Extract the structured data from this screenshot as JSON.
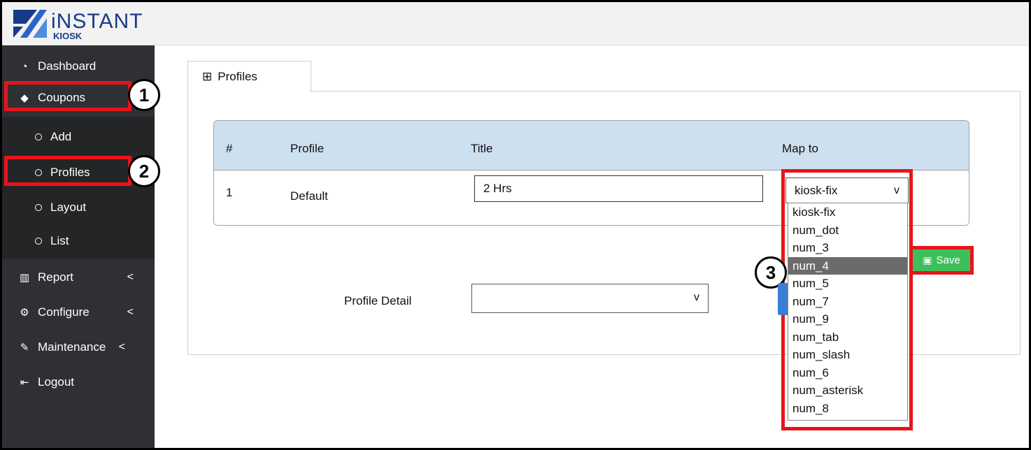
{
  "app": {
    "brand": "iNSTANT",
    "brand_sub": "KIOSK"
  },
  "sidebar": {
    "items": [
      {
        "icon": "dashboard-icon",
        "label": "Dashboard"
      },
      {
        "icon": "tag-icon",
        "label": "Coupons"
      },
      {
        "icon": "bar-chart-icon",
        "label": "Report"
      },
      {
        "icon": "gear-icon",
        "label": "Configure"
      },
      {
        "icon": "wrench-icon",
        "label": "Maintenance"
      },
      {
        "icon": "logout-icon",
        "label": "Logout"
      }
    ],
    "coupons_sub": [
      {
        "label": "Add"
      },
      {
        "label": "Profiles"
      },
      {
        "label": "Layout"
      },
      {
        "label": "List"
      }
    ],
    "caret": "<"
  },
  "callouts": [
    "1",
    "2",
    "3"
  ],
  "tab": {
    "label": "Profiles",
    "icon": "grid-icon"
  },
  "table": {
    "headers": [
      "#",
      "Profile",
      "Title",
      "Map to"
    ],
    "rows": [
      {
        "num": "1",
        "profile": "Default",
        "title": "2 Hrs",
        "map_to": "kiosk-fix"
      }
    ]
  },
  "map_dropdown": {
    "chevron": "v",
    "options": [
      "kiosk-fix",
      "num_dot",
      "num_3",
      "num_4",
      "num_5",
      "num_7",
      "num_9",
      "num_tab",
      "num_slash",
      "num_6",
      "num_asterisk",
      "num_8"
    ],
    "highlighted": "num_4"
  },
  "save_button": {
    "label": "Save",
    "icon": "floppy-disk-icon",
    "color": "#3fbf5b"
  },
  "profile_detail": {
    "label": "Profile Detail",
    "value": "",
    "chevron": "v"
  },
  "colors": {
    "highlight": "#e8141b",
    "sidebar": "#2f3033",
    "table_header": "#cde0f0"
  }
}
